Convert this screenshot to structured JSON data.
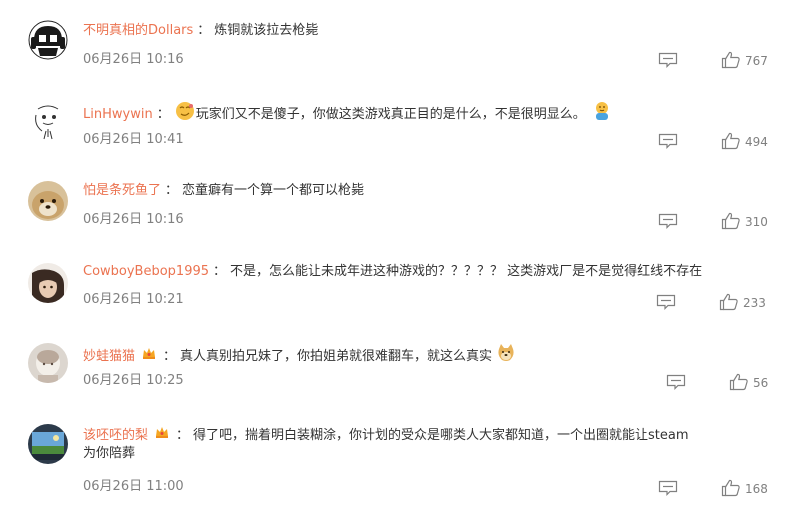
{
  "comments": [
    {
      "username": "不明真相的Dollars",
      "text": "炼铜就该拉去枪毙",
      "time": "06月26日 10:16",
      "likes": "767"
    },
    {
      "username": "LinHwywin",
      "text": "玩家们又不是傻子，你做这类游戏真正目的是什么，不是很明显么。",
      "time": "06月26日 10:41",
      "likes": "494"
    },
    {
      "username": "怕是条死鱼了",
      "text": "恋童癖有一个算一个都可以枪毙",
      "time": "06月26日 10:16",
      "likes": "310"
    },
    {
      "username": "CowboyBebop1995",
      "text": "不是，怎么能让未成年进这种游戏的？？？？？ 这类游戏厂是不是觉得红线不存在",
      "time": "06月26日 10:21",
      "likes": "233"
    },
    {
      "username": "妙蛙猫猫",
      "text": "真人真别拍兄妹了，你拍姐弟就很难翻车，就这么真实",
      "time": "06月26日 10:25",
      "likes": "56"
    },
    {
      "username": "该呸呸的梨",
      "text_line1": "得了吧，揣着明白装糊涂，你计划的受众是哪类人大家都知道，一个出圈就能让steam",
      "text_line2": "为你陪葬",
      "time": "06月26日 11:00",
      "likes": "168"
    }
  ],
  "colors": {
    "username": "#eb7350",
    "text": "#333333",
    "meta": "#808080"
  },
  "icons": {
    "reply": "comment-icon",
    "like": "thumbs-up-icon",
    "badge": "member-crown-icon"
  }
}
